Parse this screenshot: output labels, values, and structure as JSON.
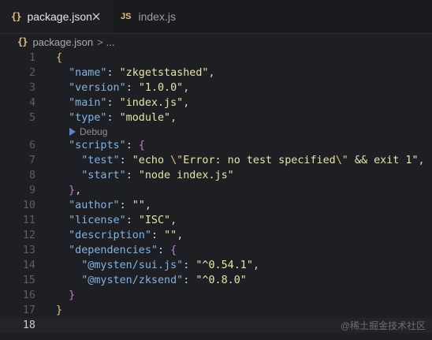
{
  "tabs": [
    {
      "icon": "{}",
      "label": "package.json",
      "close": "×"
    },
    {
      "icon": "JS",
      "label": "index.js"
    }
  ],
  "breadcrumb": {
    "icon": "{}",
    "file": "package.json",
    "separator": ">",
    "more": "..."
  },
  "codelens": {
    "label": "Debug"
  },
  "line_numbers": [
    "1",
    "2",
    "3",
    "4",
    "5",
    "6",
    "7",
    "8",
    "9",
    "10",
    "11",
    "12",
    "13",
    "14",
    "15",
    "16",
    "17",
    "18"
  ],
  "code": {
    "open_brace": "{",
    "name_key": "\"name\"",
    "name_val": "\"zkgetstashed\"",
    "version_key": "\"version\"",
    "version_val": "\"1.0.0\"",
    "main_key": "\"main\"",
    "main_val": "\"index.js\"",
    "type_key": "\"type\"",
    "type_val": "\"module\"",
    "scripts_key": "\"scripts\"",
    "scripts_open": "{",
    "test_key": "\"test\"",
    "test_val_1": "\"echo ",
    "test_esc_1": "\\\"",
    "test_val_2": "Error: no test specified",
    "test_esc_2": "\\\"",
    "test_val_3": " && exit 1\"",
    "start_key": "\"start\"",
    "start_val": "\"node index.js\"",
    "scripts_close": "}",
    "author_key": "\"author\"",
    "author_val": "\"\"",
    "license_key": "\"license\"",
    "license_val": "\"ISC\"",
    "description_key": "\"description\"",
    "description_val": "\"\"",
    "dependencies_key": "\"dependencies\"",
    "dependencies_open": "{",
    "dep1_key": "\"@mysten/sui.js\"",
    "dep1_val": "\"^0.54.1\"",
    "dep2_key": "\"@mysten/zksend\"",
    "dep2_val": "\"^0.8.0\"",
    "dependencies_close": "}",
    "close_brace": "}"
  },
  "watermark": "@稀土掘金技术社区",
  "colors": {
    "background": "#1e1f22",
    "key": "#7fb4e8",
    "string": "#e8e4a6",
    "brace": "#e5c07b",
    "nested_brace": "#c678dd"
  }
}
